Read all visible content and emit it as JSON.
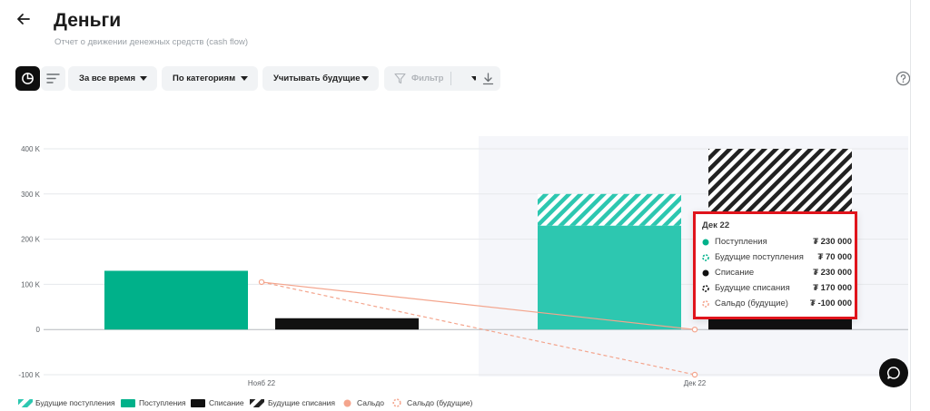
{
  "header": {
    "title": "Деньги",
    "subtitle": "Отчет о движении денежных средств (cash flow)"
  },
  "toolbar": {
    "period": "За все время",
    "grouping": "По категориям",
    "future": "Учитывать будущие",
    "filter": "Фильтр"
  },
  "icons": {
    "back": "arrow-left-icon",
    "chart_view": "pie-chart-icon",
    "list_view": "list-icon",
    "filter": "funnel-icon",
    "download": "download-icon",
    "help": "question-icon",
    "chat": "chat-icon"
  },
  "colors": {
    "income": "#00b18a",
    "income_dec": "#2dc7b0",
    "expense": "#111111",
    "balance": "#f4a58d",
    "highlight_bg": "#f5f6fa",
    "tooltip_border": "#e0141c"
  },
  "chart_data": {
    "type": "bar",
    "categories": [
      "Нояб 22",
      "Дек 22"
    ],
    "ylim": [
      -100000,
      400000
    ],
    "y_ticks": [
      {
        "value": 400000,
        "label": "400 K"
      },
      {
        "value": 300000,
        "label": "300 K"
      },
      {
        "value": 200000,
        "label": "200 K"
      },
      {
        "value": 100000,
        "label": "100 K"
      },
      {
        "value": 0,
        "label": "0"
      },
      {
        "value": -100000,
        "label": "-100 K"
      }
    ],
    "grid": true,
    "highlighted_category": "Дек 22",
    "series": [
      {
        "name": "Поступления",
        "values": [
          130000,
          230000
        ]
      },
      {
        "name": "Будущие поступления",
        "values": [
          0,
          70000
        ]
      },
      {
        "name": "Списание",
        "values": [
          25000,
          230000
        ]
      },
      {
        "name": "Будущие списания",
        "values": [
          0,
          170000
        ]
      },
      {
        "name": "Сальдо",
        "values": [
          105000,
          0
        ]
      },
      {
        "name": "Сальдо (будущие)",
        "values": [
          105000,
          -100000
        ]
      }
    ],
    "legend_position": "bottom-left"
  },
  "tooltip": {
    "title": "Дек 22",
    "rows": [
      {
        "label": "Поступления",
        "value": "₮ 230 000"
      },
      {
        "label": "Будущие поступления",
        "value": "₮ 70 000"
      },
      {
        "label": "Списание",
        "value": "₮ 230 000"
      },
      {
        "label": "Будущие списания",
        "value": "₮ 170 000"
      },
      {
        "label": "Сальдо (будущие)",
        "value": "₮ -100 000"
      }
    ]
  },
  "legend": [
    {
      "label": "Будущие поступления",
      "marker": "hatch-green"
    },
    {
      "label": "Поступления",
      "marker": "solid-green"
    },
    {
      "label": "Списание",
      "marker": "solid-black"
    },
    {
      "label": "Будущие списания",
      "marker": "hatch-black"
    },
    {
      "label": "Сальдо",
      "marker": "dot-salmon"
    },
    {
      "label": "Сальдо (будущие)",
      "marker": "dashed-salmon"
    }
  ]
}
